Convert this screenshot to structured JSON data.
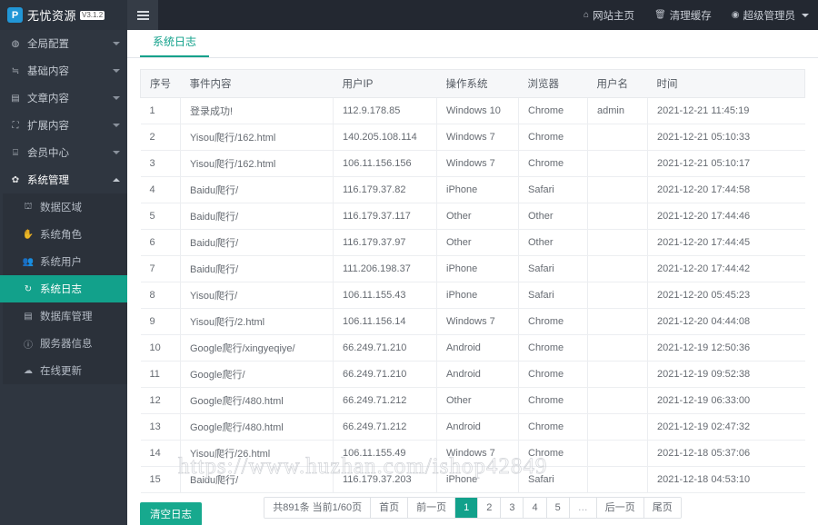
{
  "brand": {
    "logo_glyph": "P",
    "name": "无忧资源",
    "version": "V3.1.2",
    "logo_color": "#2196d6"
  },
  "topbar": {
    "background": "#232831",
    "items": [
      {
        "icon": "home-icon",
        "glyph": "⌂",
        "label": "网站主页"
      },
      {
        "icon": "trash-icon",
        "glyph": "🗑",
        "label": "清理缓存"
      },
      {
        "icon": "user-circle-icon",
        "glyph": "◉",
        "label": "超级管理员",
        "has_caret": true
      }
    ]
  },
  "sidebar": {
    "background": "#2f3640",
    "active_color": "#12a18b",
    "items": [
      {
        "icon": "globe-icon",
        "glyph": "◍",
        "label": "全局配置",
        "expanded": false
      },
      {
        "icon": "sliders-icon",
        "glyph": "≒",
        "label": "基础内容",
        "expanded": false
      },
      {
        "icon": "document-icon",
        "glyph": "▤",
        "label": "文章内容",
        "expanded": false
      },
      {
        "icon": "expand-icon",
        "glyph": "⛶",
        "label": "扩展内容",
        "expanded": false
      },
      {
        "icon": "lock-icon",
        "glyph": "⌸",
        "label": "会员中心",
        "expanded": false
      },
      {
        "icon": "gear-icon",
        "glyph": "✿",
        "label": "系统管理",
        "expanded": true
      }
    ],
    "submenu": [
      {
        "icon": "sitemap-icon",
        "glyph": "⛫",
        "label": "数据区域",
        "active": false
      },
      {
        "icon": "hand-icon",
        "glyph": "✋",
        "label": "系统角色",
        "active": false
      },
      {
        "icon": "users-icon",
        "glyph": "👥",
        "label": "系统用户",
        "active": false
      },
      {
        "icon": "history-icon",
        "glyph": "↻",
        "label": "系统日志",
        "active": true
      },
      {
        "icon": "database-icon",
        "glyph": "▤",
        "label": "数据库管理",
        "active": false
      },
      {
        "icon": "info-icon",
        "glyph": "ⓘ",
        "label": "服务器信息",
        "active": false
      },
      {
        "icon": "cloud-upload-icon",
        "glyph": "☁",
        "label": "在线更新",
        "active": false
      }
    ]
  },
  "main": {
    "tab": {
      "label": "系统日志",
      "active": true
    },
    "table": {
      "headers": [
        "序号",
        "事件内容",
        "用户IP",
        "操作系统",
        "浏览器",
        "用户名",
        "时间"
      ],
      "rows": [
        [
          "1",
          "登录成功!",
          "112.9.178.85",
          "Windows 10",
          "Chrome",
          "admin",
          "2021-12-21 11:45:19"
        ],
        [
          "2",
          "Yisou爬行/162.html",
          "140.205.108.114",
          "Windows 7",
          "Chrome",
          "",
          "2021-12-21 05:10:33"
        ],
        [
          "3",
          "Yisou爬行/162.html",
          "106.11.156.156",
          "Windows 7",
          "Chrome",
          "",
          "2021-12-21 05:10:17"
        ],
        [
          "4",
          "Baidu爬行/",
          "116.179.37.82",
          "iPhone",
          "Safari",
          "",
          "2021-12-20 17:44:58"
        ],
        [
          "5",
          "Baidu爬行/",
          "116.179.37.117",
          "Other",
          "Other",
          "",
          "2021-12-20 17:44:46"
        ],
        [
          "6",
          "Baidu爬行/",
          "116.179.37.97",
          "Other",
          "Other",
          "",
          "2021-12-20 17:44:45"
        ],
        [
          "7",
          "Baidu爬行/",
          "111.206.198.37",
          "iPhone",
          "Safari",
          "",
          "2021-12-20 17:44:42"
        ],
        [
          "8",
          "Yisou爬行/",
          "106.11.155.43",
          "iPhone",
          "Safari",
          "",
          "2021-12-20 05:45:23"
        ],
        [
          "9",
          "Yisou爬行/2.html",
          "106.11.156.14",
          "Windows 7",
          "Chrome",
          "",
          "2021-12-20 04:44:08"
        ],
        [
          "10",
          "Google爬行/xingyeqiye/",
          "66.249.71.210",
          "Android",
          "Chrome",
          "",
          "2021-12-19 12:50:36"
        ],
        [
          "11",
          "Google爬行/",
          "66.249.71.210",
          "Android",
          "Chrome",
          "",
          "2021-12-19 09:52:38"
        ],
        [
          "12",
          "Google爬行/480.html",
          "66.249.71.212",
          "Other",
          "Chrome",
          "",
          "2021-12-19 06:33:00"
        ],
        [
          "13",
          "Google爬行/480.html",
          "66.249.71.212",
          "Android",
          "Chrome",
          "",
          "2021-12-19 02:47:32"
        ],
        [
          "14",
          "Yisou爬行/26.html",
          "106.11.155.49",
          "Windows 7",
          "Chrome",
          "",
          "2021-12-18 05:37:06"
        ],
        [
          "15",
          "Baidu爬行/",
          "116.179.37.203",
          "iPhone",
          "Safari",
          "",
          "2021-12-18 04:53:10"
        ]
      ]
    },
    "clear_button": {
      "label": "清空日志",
      "color": "#17a98e"
    },
    "pagination": {
      "summary": "共891条 当前1/60页",
      "first": "首页",
      "prev": "前一页",
      "pages": [
        "1",
        "2",
        "3",
        "4",
        "5"
      ],
      "ellipsis": "…",
      "next": "后一页",
      "last": "尾页",
      "current": "1",
      "total_records": 891,
      "total_pages": 60
    }
  },
  "watermark": {
    "text": "https://www.huzhan.com/ishop42849"
  }
}
